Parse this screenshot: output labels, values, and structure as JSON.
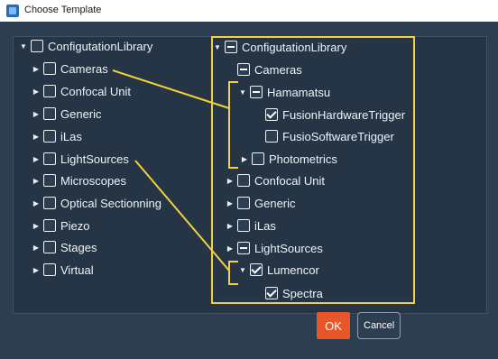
{
  "window": {
    "title": "Choose Template",
    "icon": "app-icon"
  },
  "left_tree": {
    "root": {
      "label": "ConfigutationLibrary",
      "expanded": true,
      "checked": false
    },
    "items": [
      {
        "label": "Cameras",
        "checked": false
      },
      {
        "label": "Confocal Unit",
        "checked": false
      },
      {
        "label": "Generic",
        "checked": false
      },
      {
        "label": "iLas",
        "checked": false
      },
      {
        "label": "LightSources",
        "checked": false
      },
      {
        "label": "Microscopes",
        "checked": false
      },
      {
        "label": "Optical Sectionning",
        "checked": false
      },
      {
        "label": "Piezo",
        "checked": false
      },
      {
        "label": "Stages",
        "checked": false
      },
      {
        "label": "Virtual",
        "checked": false
      }
    ]
  },
  "right_tree": {
    "root": {
      "label": "ConfigutationLibrary",
      "state": "partial"
    },
    "cameras": {
      "label": "Cameras",
      "state": "partial"
    },
    "hamamatsu": {
      "label": "Hamamatsu",
      "state": "partial"
    },
    "fusion_hw": {
      "label": "FusionHardwareTrigger",
      "state": "checked"
    },
    "fusion_sw": {
      "label": "FusioSoftwareTrigger",
      "state": "unchecked"
    },
    "photometrics": {
      "label": "Photometrics",
      "state": "unchecked"
    },
    "confocal": {
      "label": "Confocal Unit",
      "state": "unchecked"
    },
    "generic": {
      "label": "Generic",
      "state": "unchecked"
    },
    "ilas": {
      "label": "iLas",
      "state": "unchecked"
    },
    "lightsources": {
      "label": "LightSources",
      "state": "partial"
    },
    "lumencor": {
      "label": "Lumencor",
      "state": "checked"
    },
    "spectra": {
      "label": "Spectra",
      "state": "checked"
    }
  },
  "buttons": {
    "ok": "OK",
    "cancel": "Cancel"
  },
  "colors": {
    "background": "#2c3e50",
    "panel": "#253545",
    "highlight": "#f2d13c",
    "ok_button": "#e8572a"
  }
}
